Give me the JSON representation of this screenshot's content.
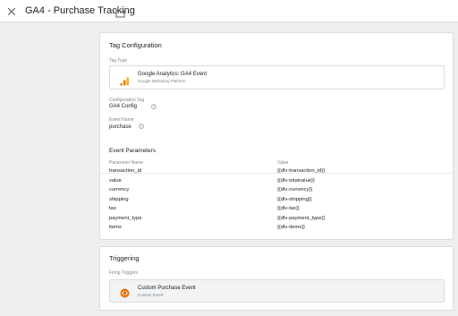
{
  "header": {
    "title": "GA4 - Purchase Tracking"
  },
  "tag_configuration": {
    "section_title": "Tag Configuration",
    "tag_type_label": "Tag Type",
    "tag_type_name": "Google Analytics: GA4 Event",
    "tag_type_vendor": "Google Marketing Platform",
    "configuration_tag_label": "Configuration Tag",
    "configuration_tag_value": "GA4 Config",
    "event_name_label": "Event Name",
    "event_name_value": "purchase",
    "event_parameters_title": "Event Parameters",
    "column_headers": {
      "name": "Parameter Name",
      "value": "Value"
    },
    "parameters": [
      {
        "name": "transaction_id",
        "value": "{{dlv-transaction_id}}"
      },
      {
        "name": "value",
        "value": "{{dlv-totalvalue}}"
      },
      {
        "name": "currency",
        "value": "{{dlv-currency}}"
      },
      {
        "name": "shipping",
        "value": "{{dlv-shipping}}"
      },
      {
        "name": "tax",
        "value": "{{dlv-tax}}"
      },
      {
        "name": "payment_type",
        "value": "{{dlv-payment_type}}"
      },
      {
        "name": "items",
        "value": "{{dlv-items}}"
      }
    ]
  },
  "triggering": {
    "section_title": "Triggering",
    "firing_triggers_label": "Firing Triggers",
    "trigger_name": "Custom Purchase Event",
    "trigger_type": "Custom Event"
  },
  "icons": {
    "close": "close-icon",
    "folder": "folder-icon",
    "tag_type": "ga-bars-icon",
    "help": "help-circle-icon",
    "trigger": "custom-event-icon"
  },
  "colors": {
    "ga_orange": "#f9ab00",
    "ga_dark_orange": "#e37400",
    "trigger_orange": "#e8710a"
  }
}
